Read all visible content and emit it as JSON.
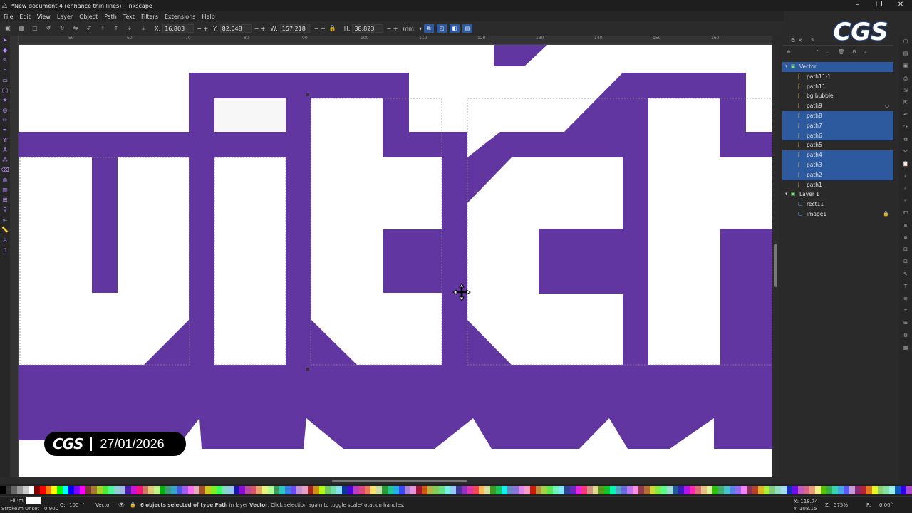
{
  "window": {
    "title": "*New document 4 (enhance thin lines) - Inkscape",
    "controls": [
      "–",
      "❐",
      "✕"
    ]
  },
  "menu": [
    "File",
    "Edit",
    "View",
    "Layer",
    "Object",
    "Path",
    "Text",
    "Filters",
    "Extensions",
    "Help"
  ],
  "toolbar": {
    "x_label": "X:",
    "x_value": "16.803",
    "y_label": "Y:",
    "y_value": "82.048",
    "w_label": "W:",
    "w_value": "157.218",
    "h_label": "H:",
    "h_value": "38.823",
    "unit": "mm"
  },
  "ruler_ticks": [
    "50",
    "60",
    "70",
    "80",
    "90",
    "100",
    "110",
    "120",
    "130",
    "140",
    "150",
    "160"
  ],
  "layers": [
    {
      "label": "Vector",
      "icon": "group-icon",
      "indent": 0,
      "selected": true,
      "expand": "▾"
    },
    {
      "label": "path11-1",
      "icon": "path-icon",
      "indent": 1,
      "selected": false
    },
    {
      "label": "path11",
      "icon": "path-icon",
      "indent": 1,
      "selected": false
    },
    {
      "label": "bg bubble",
      "icon": "path-icon",
      "indent": 1,
      "selected": false
    },
    {
      "label": "path9",
      "icon": "path-icon",
      "indent": 1,
      "selected": false,
      "hidden_mark": true
    },
    {
      "label": "path8",
      "icon": "path-icon",
      "indent": 1,
      "selected": true
    },
    {
      "label": "path7",
      "icon": "path-icon",
      "indent": 1,
      "selected": true
    },
    {
      "label": "path6",
      "icon": "path-icon",
      "indent": 1,
      "selected": true
    },
    {
      "label": "path5",
      "icon": "path-icon",
      "indent": 1,
      "selected": false
    },
    {
      "label": "path4",
      "icon": "path-icon",
      "indent": 1,
      "selected": true
    },
    {
      "label": "path3",
      "icon": "path-icon",
      "indent": 1,
      "selected": true
    },
    {
      "label": "path2",
      "icon": "path-icon",
      "indent": 1,
      "selected": true
    },
    {
      "label": "path1",
      "icon": "path-icon",
      "indent": 1,
      "selected": false
    },
    {
      "label": "Layer 1",
      "icon": "group-icon",
      "indent": 0,
      "selected": false,
      "expand": "▾"
    },
    {
      "label": "rect11",
      "icon": "rect-icon",
      "indent": 1,
      "selected": false
    },
    {
      "label": "image1",
      "icon": "image-icon",
      "indent": 1,
      "selected": false,
      "locked": true
    }
  ],
  "status": {
    "fill_label": "Fill:",
    "fill_value": "m",
    "stroke_label": "Stroke:",
    "stroke_value": "m Unset",
    "stroke_width": "0.900",
    "opacity_label": "O:",
    "opacity_value": "100",
    "layer_name": "Vector",
    "message_pre": "6 objects selected of type ",
    "message_type": "Path",
    "message_mid": " in layer ",
    "message_layer": "Vector",
    "message_post": ". Click selection again to toggle scale/rotation handles.",
    "cursor_x": "X: 118.74",
    "cursor_y": "Y: 108.15",
    "zoom_label": "Z:",
    "zoom_value": "575%",
    "rotation_label": "R:",
    "rotation_value": "0.00°"
  },
  "badge": {
    "logo": "CGS",
    "date": "27/01/2026"
  },
  "logo_text": "CGS",
  "colors": {
    "artwork_purple": "#6236a0",
    "selection_blue": "#2d5a9e",
    "canvas_white": "#ffffff"
  }
}
